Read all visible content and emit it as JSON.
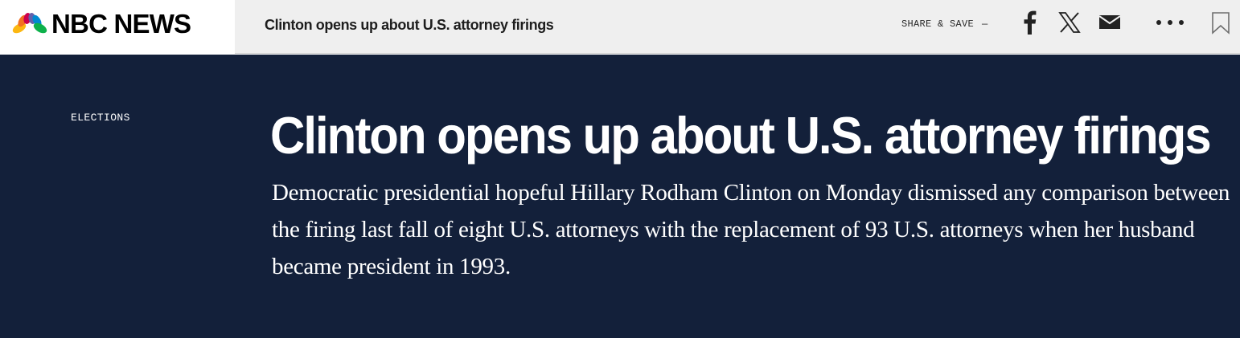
{
  "header": {
    "logo_text": "NBC NEWS",
    "article_title": "Clinton opens up about U.S. attorney firings",
    "share_label": "SHARE & SAVE",
    "share_dash": "—",
    "icons": [
      "nbc-peacock-icon",
      "facebook-icon",
      "x-icon",
      "mail-icon",
      "more-icon",
      "bookmark-icon"
    ]
  },
  "article": {
    "section": "ELECTIONS",
    "headline": "Clinton opens up about U.S. attorney firings",
    "dek": "Democratic presidential hopeful Hillary Rodham Clinton on Monday dismissed any comparison between the firing last fall of eight U.S. attorneys with the replacement of 93 U.S. attorneys when her husband became president in 1993."
  },
  "colors": {
    "hero_background": "#13203a",
    "header_background": "#efefef",
    "text_light": "#ffffff"
  }
}
